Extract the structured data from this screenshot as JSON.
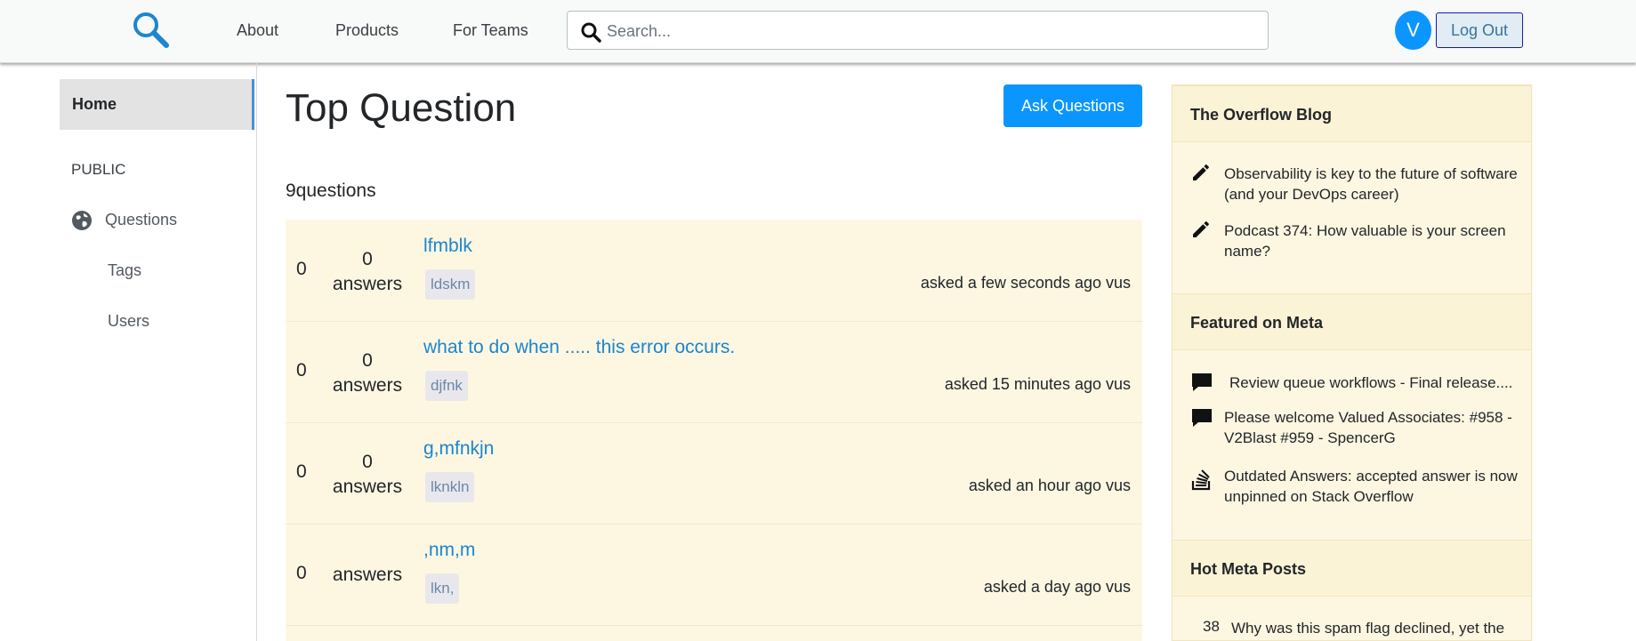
{
  "header": {
    "logo_icon": "search-magnifier-logo",
    "nav": [
      "About",
      "Products",
      "For Teams"
    ],
    "search_placeholder": "Search...",
    "avatar_initial": "V",
    "logout_label": "Log Out",
    "accent_color": "#0a95ff"
  },
  "sidebar": {
    "home_label": "Home",
    "section_label": "PUBLIC",
    "items": [
      {
        "label": "Questions",
        "icon": "globe-icon"
      },
      {
        "label": "Tags"
      },
      {
        "label": "Users"
      }
    ]
  },
  "main": {
    "title": "Top Question",
    "ask_label": "Ask Questions",
    "count_label": "9questions",
    "questions": [
      {
        "votes": "0",
        "answers_count": "0",
        "answers_label": "answers",
        "title": "lfmblk",
        "tag": "ldskm",
        "asked": "asked a few seconds ago vus"
      },
      {
        "votes": "0",
        "answers_count": "0",
        "answers_label": "answers",
        "title": "what to do when ..... this error occurs.",
        "tag": "djfnk",
        "asked": "asked 15 minutes ago vus"
      },
      {
        "votes": "0",
        "answers_count": "0",
        "answers_label": "answers",
        "title": "g,mfnkjn",
        "tag": "lknkln",
        "asked": "asked an hour ago vus"
      },
      {
        "votes": "0",
        "answers_count": "",
        "answers_label": "answers",
        "title": ",nm,m",
        "tag": "lkn,",
        "asked": "asked a day ago vus"
      }
    ]
  },
  "right_panel": {
    "blog_title": "The Overflow Blog",
    "blog_items": [
      {
        "icon": "pencil-icon",
        "text": "Observability is key to the future of software (and your DevOps career)"
      },
      {
        "icon": "pencil-icon",
        "text": "Podcast 374: How valuable is your screen name?"
      }
    ],
    "meta_title": "Featured on Meta",
    "meta_items": [
      {
        "icon": "comment-icon",
        "text": "Review queue workflows - Final release...."
      },
      {
        "icon": "comment-icon",
        "text": "Please welcome Valued Associates: #958 - V2Blast #959 - SpencerG"
      },
      {
        "icon": "stack-icon",
        "text": "Outdated Answers: accepted answer is now unpinned on Stack Overflow"
      }
    ],
    "hot_title": "Hot Meta Posts",
    "hot_items": [
      {
        "count": "38",
        "text": "Why was this spam flag declined, yet the"
      }
    ]
  }
}
